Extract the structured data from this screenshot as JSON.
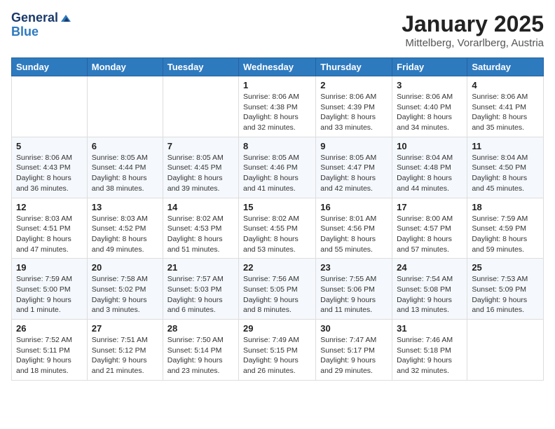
{
  "header": {
    "logo_line1": "General",
    "logo_line2": "Blue",
    "month": "January 2025",
    "location": "Mittelberg, Vorarlberg, Austria"
  },
  "weekdays": [
    "Sunday",
    "Monday",
    "Tuesday",
    "Wednesday",
    "Thursday",
    "Friday",
    "Saturday"
  ],
  "weeks": [
    [
      {
        "day": "",
        "info": ""
      },
      {
        "day": "",
        "info": ""
      },
      {
        "day": "",
        "info": ""
      },
      {
        "day": "1",
        "info": "Sunrise: 8:06 AM\nSunset: 4:38 PM\nDaylight: 8 hours and 32 minutes."
      },
      {
        "day": "2",
        "info": "Sunrise: 8:06 AM\nSunset: 4:39 PM\nDaylight: 8 hours and 33 minutes."
      },
      {
        "day": "3",
        "info": "Sunrise: 8:06 AM\nSunset: 4:40 PM\nDaylight: 8 hours and 34 minutes."
      },
      {
        "day": "4",
        "info": "Sunrise: 8:06 AM\nSunset: 4:41 PM\nDaylight: 8 hours and 35 minutes."
      }
    ],
    [
      {
        "day": "5",
        "info": "Sunrise: 8:06 AM\nSunset: 4:43 PM\nDaylight: 8 hours and 36 minutes."
      },
      {
        "day": "6",
        "info": "Sunrise: 8:05 AM\nSunset: 4:44 PM\nDaylight: 8 hours and 38 minutes."
      },
      {
        "day": "7",
        "info": "Sunrise: 8:05 AM\nSunset: 4:45 PM\nDaylight: 8 hours and 39 minutes."
      },
      {
        "day": "8",
        "info": "Sunrise: 8:05 AM\nSunset: 4:46 PM\nDaylight: 8 hours and 41 minutes."
      },
      {
        "day": "9",
        "info": "Sunrise: 8:05 AM\nSunset: 4:47 PM\nDaylight: 8 hours and 42 minutes."
      },
      {
        "day": "10",
        "info": "Sunrise: 8:04 AM\nSunset: 4:48 PM\nDaylight: 8 hours and 44 minutes."
      },
      {
        "day": "11",
        "info": "Sunrise: 8:04 AM\nSunset: 4:50 PM\nDaylight: 8 hours and 45 minutes."
      }
    ],
    [
      {
        "day": "12",
        "info": "Sunrise: 8:03 AM\nSunset: 4:51 PM\nDaylight: 8 hours and 47 minutes."
      },
      {
        "day": "13",
        "info": "Sunrise: 8:03 AM\nSunset: 4:52 PM\nDaylight: 8 hours and 49 minutes."
      },
      {
        "day": "14",
        "info": "Sunrise: 8:02 AM\nSunset: 4:53 PM\nDaylight: 8 hours and 51 minutes."
      },
      {
        "day": "15",
        "info": "Sunrise: 8:02 AM\nSunset: 4:55 PM\nDaylight: 8 hours and 53 minutes."
      },
      {
        "day": "16",
        "info": "Sunrise: 8:01 AM\nSunset: 4:56 PM\nDaylight: 8 hours and 55 minutes."
      },
      {
        "day": "17",
        "info": "Sunrise: 8:00 AM\nSunset: 4:57 PM\nDaylight: 8 hours and 57 minutes."
      },
      {
        "day": "18",
        "info": "Sunrise: 7:59 AM\nSunset: 4:59 PM\nDaylight: 8 hours and 59 minutes."
      }
    ],
    [
      {
        "day": "19",
        "info": "Sunrise: 7:59 AM\nSunset: 5:00 PM\nDaylight: 9 hours and 1 minute."
      },
      {
        "day": "20",
        "info": "Sunrise: 7:58 AM\nSunset: 5:02 PM\nDaylight: 9 hours and 3 minutes."
      },
      {
        "day": "21",
        "info": "Sunrise: 7:57 AM\nSunset: 5:03 PM\nDaylight: 9 hours and 6 minutes."
      },
      {
        "day": "22",
        "info": "Sunrise: 7:56 AM\nSunset: 5:05 PM\nDaylight: 9 hours and 8 minutes."
      },
      {
        "day": "23",
        "info": "Sunrise: 7:55 AM\nSunset: 5:06 PM\nDaylight: 9 hours and 11 minutes."
      },
      {
        "day": "24",
        "info": "Sunrise: 7:54 AM\nSunset: 5:08 PM\nDaylight: 9 hours and 13 minutes."
      },
      {
        "day": "25",
        "info": "Sunrise: 7:53 AM\nSunset: 5:09 PM\nDaylight: 9 hours and 16 minutes."
      }
    ],
    [
      {
        "day": "26",
        "info": "Sunrise: 7:52 AM\nSunset: 5:11 PM\nDaylight: 9 hours and 18 minutes."
      },
      {
        "day": "27",
        "info": "Sunrise: 7:51 AM\nSunset: 5:12 PM\nDaylight: 9 hours and 21 minutes."
      },
      {
        "day": "28",
        "info": "Sunrise: 7:50 AM\nSunset: 5:14 PM\nDaylight: 9 hours and 23 minutes."
      },
      {
        "day": "29",
        "info": "Sunrise: 7:49 AM\nSunset: 5:15 PM\nDaylight: 9 hours and 26 minutes."
      },
      {
        "day": "30",
        "info": "Sunrise: 7:47 AM\nSunset: 5:17 PM\nDaylight: 9 hours and 29 minutes."
      },
      {
        "day": "31",
        "info": "Sunrise: 7:46 AM\nSunset: 5:18 PM\nDaylight: 9 hours and 32 minutes."
      },
      {
        "day": "",
        "info": ""
      }
    ]
  ]
}
